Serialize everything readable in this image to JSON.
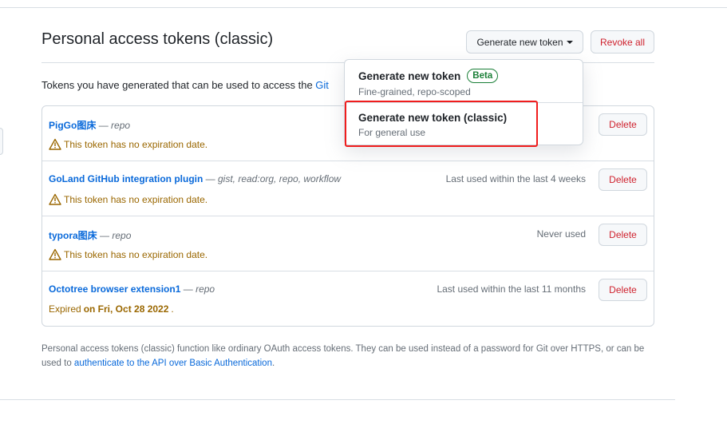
{
  "header": {
    "title": "Personal access tokens (classic)",
    "generate_label": "Generate new token",
    "revoke_label": "Revoke all"
  },
  "intro": {
    "text": "Tokens you have generated that can be used to access the ",
    "link": "Git"
  },
  "tokens": [
    {
      "name": "PigGo图床",
      "scopes": "repo",
      "last_used": "",
      "note_type": "warning",
      "note": "This token has no expiration date.",
      "delete_label": "Delete"
    },
    {
      "name": "GoLand GitHub integration plugin",
      "scopes": "gist, read:org, repo, workflow",
      "last_used": "Last used within the last 4 weeks",
      "note_type": "warning",
      "note": "This token has no expiration date.",
      "delete_label": "Delete"
    },
    {
      "name": "typora图床",
      "scopes": "repo",
      "last_used": "Never used",
      "note_type": "warning",
      "note": "This token has no expiration date.",
      "delete_label": "Delete"
    },
    {
      "name": "Octotree browser extension1",
      "scopes": "repo",
      "last_used": "Last used within the last 11 months",
      "note_type": "expired",
      "note": "Expired",
      "note_date": "on Fri, Oct 28 2022",
      "delete_label": "Delete"
    }
  ],
  "footer": {
    "text": "Personal access tokens (classic) function like ordinary OAuth access tokens. They can be used instead of a password for Git over HTTPS, or can be used to ",
    "link": "authenticate to the API over Basic Authentication",
    "end": "."
  },
  "menu": {
    "items": [
      {
        "title": "Generate new token",
        "badge": "Beta",
        "subtitle": "Fine-grained, repo-scoped"
      },
      {
        "title": "Generate new token (classic)",
        "subtitle": "For general use",
        "highlighted": true
      }
    ]
  },
  "colors": {
    "link": "#0969da",
    "danger": "#cf222e",
    "warning": "#9a6700",
    "success": "#1a7f37",
    "highlight": "#f01d1d"
  }
}
